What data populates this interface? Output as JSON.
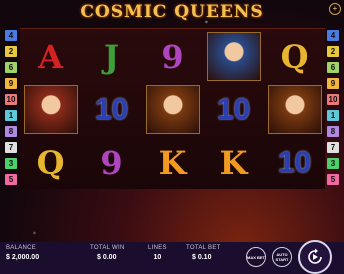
{
  "game": {
    "title": "COSMIC QUEENS",
    "menu_icon": "plus-icon"
  },
  "paylines_left": [
    {
      "n": "4",
      "color": "#4a7be0"
    },
    {
      "n": "2",
      "color": "#e8c840"
    },
    {
      "n": "6",
      "color": "#9fd26a"
    },
    {
      "n": "9",
      "color": "#f0b840"
    },
    {
      "n": "10",
      "color": "#e87a7a"
    },
    {
      "n": "1",
      "color": "#5ec7d8"
    },
    {
      "n": "8",
      "color": "#b08ae0"
    },
    {
      "n": "7",
      "color": "#e0e0e0"
    },
    {
      "n": "3",
      "color": "#4bd06a"
    },
    {
      "n": "5",
      "color": "#ee6aa0"
    }
  ],
  "paylines_right": [
    {
      "n": "4",
      "color": "#4a7be0"
    },
    {
      "n": "2",
      "color": "#e8c840"
    },
    {
      "n": "6",
      "color": "#9fd26a"
    },
    {
      "n": "9",
      "color": "#f0b840"
    },
    {
      "n": "10",
      "color": "#e87a7a"
    },
    {
      "n": "1",
      "color": "#5ec7d8"
    },
    {
      "n": "8",
      "color": "#b08ae0"
    },
    {
      "n": "7",
      "color": "#e0e0e0"
    },
    {
      "n": "3",
      "color": "#4bd06a"
    },
    {
      "n": "5",
      "color": "#ee6aa0"
    }
  ],
  "reels": [
    [
      {
        "type": "letter",
        "text": "A",
        "color": "#d42222"
      },
      {
        "type": "portrait",
        "name": "red-queen",
        "color": "#8a2a1a"
      },
      {
        "type": "letter",
        "text": "Q",
        "color": "#e8b52e"
      }
    ],
    [
      {
        "type": "letter",
        "text": "J",
        "color": "#3e9e3a"
      },
      {
        "type": "num",
        "text": "10"
      },
      {
        "type": "letter",
        "text": "9",
        "color": "#b045c0"
      }
    ],
    [
      {
        "type": "letter",
        "text": "9",
        "color": "#b045c0"
      },
      {
        "type": "portrait",
        "name": "gold-queen",
        "color": "#7a3a10"
      },
      {
        "type": "letter",
        "text": "K",
        "color": "#f09a20"
      }
    ],
    [
      {
        "type": "portrait",
        "name": "blue-queen",
        "color": "#2a4a8a"
      },
      {
        "type": "num",
        "text": "10"
      },
      {
        "type": "letter",
        "text": "K",
        "color": "#f09a20"
      }
    ],
    [
      {
        "type": "letter",
        "text": "Q",
        "color": "#e8b52e"
      },
      {
        "type": "portrait",
        "name": "gold-queen",
        "color": "#7a3a10"
      },
      {
        "type": "num",
        "text": "10"
      }
    ]
  ],
  "hud": {
    "balance_label": "BALANCE",
    "balance": "$ 2,000.00",
    "total_win_label": "TOTAL WIN",
    "total_win": "$ 0.00",
    "lines_label": "LINES",
    "lines": "10",
    "total_bet_label": "TOTAL BET",
    "total_bet": "$ 0.10",
    "max_bet": "MAX BET",
    "auto_start": "AUTO START"
  }
}
